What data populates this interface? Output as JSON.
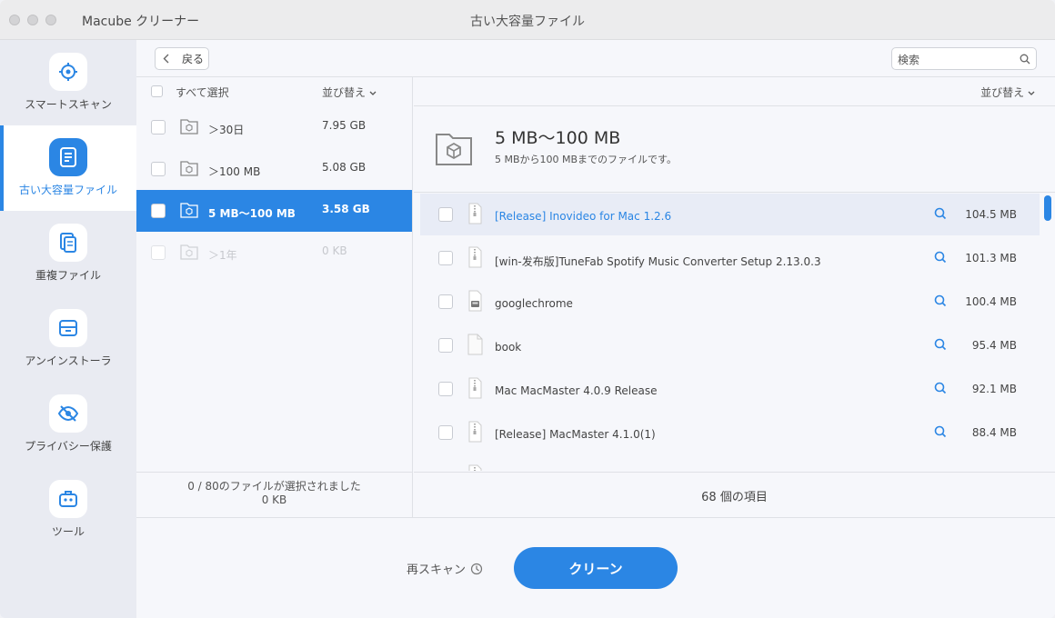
{
  "app": {
    "name": "Macube クリーナー",
    "window_title": "古い大容量ファイル"
  },
  "colors": {
    "accent": "#2b86e4"
  },
  "sidebar": {
    "items": [
      {
        "label": "スマートスキャン",
        "icon": "target-icon",
        "active": false
      },
      {
        "label": "古い大容量ファイル",
        "icon": "document-icon",
        "active": true
      },
      {
        "label": "重複ファイル",
        "icon": "duplicate-files-icon",
        "active": false
      },
      {
        "label": "アンインストーラ",
        "icon": "archive-box-icon",
        "active": false
      },
      {
        "label": "プライバシー保護",
        "icon": "eye-off-icon",
        "active": false
      },
      {
        "label": "ツール",
        "icon": "toolbox-icon",
        "active": false
      }
    ]
  },
  "toolbar": {
    "back_label": "戻る",
    "search_placeholder": "検索"
  },
  "left_pane": {
    "select_all_label": "すべて選択",
    "sort_label": "並び替え",
    "categories": [
      {
        "name": "＞30日",
        "size": "7.95 GB",
        "state": "normal"
      },
      {
        "name": "＞100 MB",
        "size": "5.08 GB",
        "state": "normal"
      },
      {
        "name": "5 MB〜100 MB",
        "size": "3.58 GB",
        "state": "active"
      },
      {
        "name": "＞1年",
        "size": "0 KB",
        "state": "disabled"
      }
    ],
    "footer_line1": "0 / 80のファイルが選択されました",
    "footer_line2": "0 KB"
  },
  "right_pane": {
    "sort_label": "並び替え",
    "category_title": "5 MB〜100 MB",
    "category_desc": "5 MBから100 MBまでのファイルです。",
    "files": [
      {
        "name": "[Release] Inovideo for Mac 1.2.6",
        "size": "104.5 MB",
        "icon": "zip-file-icon",
        "selected": true
      },
      {
        "name": "[win-发布版]TuneFab Spotify Music Converter Setup 2.13.0.3",
        "size": "101.3 MB",
        "icon": "zip-file-icon",
        "selected": false
      },
      {
        "name": "googlechrome",
        "size": "100.4 MB",
        "icon": "disk-image-icon",
        "selected": false
      },
      {
        "name": "book",
        "size": "95.4 MB",
        "icon": "blank-file-icon",
        "selected": false
      },
      {
        "name": "Mac MacMaster 4.0.9 Release",
        "size": "92.1 MB",
        "icon": "zip-file-icon",
        "selected": false
      },
      {
        "name": "[Release] MacMaster 4.1.0(1)",
        "size": "88.4 MB",
        "icon": "zip-file-icon",
        "selected": false
      }
    ],
    "footer": "68 個の項目"
  },
  "bottom": {
    "rescan_label": "再スキャン",
    "clean_label": "クリーン"
  }
}
